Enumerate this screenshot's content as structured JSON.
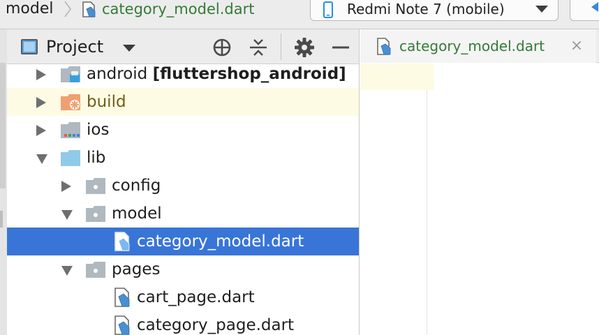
{
  "navbar": {
    "breadcrumb_prev": "model",
    "breadcrumb_file": "category_model.dart",
    "device_label": "Redmi Note 7 (mobile)"
  },
  "project_panel": {
    "title": "Project",
    "buttons": [
      "locate-target-icon",
      "collapse-all-icon",
      "gear-icon",
      "hide-minus-icon"
    ]
  },
  "tree": {
    "android": {
      "name": "android",
      "module": "[fluttershop_android]"
    },
    "build": {
      "name": "build"
    },
    "ios": {
      "name": "ios"
    },
    "lib": {
      "name": "lib"
    },
    "config": {
      "name": "config"
    },
    "model": {
      "name": "model"
    },
    "category_model": {
      "name": "category_model.dart"
    },
    "pages": {
      "name": "pages"
    },
    "cart_page": {
      "name": "cart_page.dart"
    },
    "category_page": {
      "name": "category_page.dart"
    }
  },
  "editor": {
    "tab_label": "category_model.dart",
    "tab_close": "×"
  },
  "colors": {
    "selection": "#3875d7",
    "file_green": "#357a35",
    "build_orange": "#f0a070",
    "folder_gray": "#b0b8c0",
    "folder_blue": "#8fcbe8",
    "highlight_yellow": "#fdfbe4"
  }
}
